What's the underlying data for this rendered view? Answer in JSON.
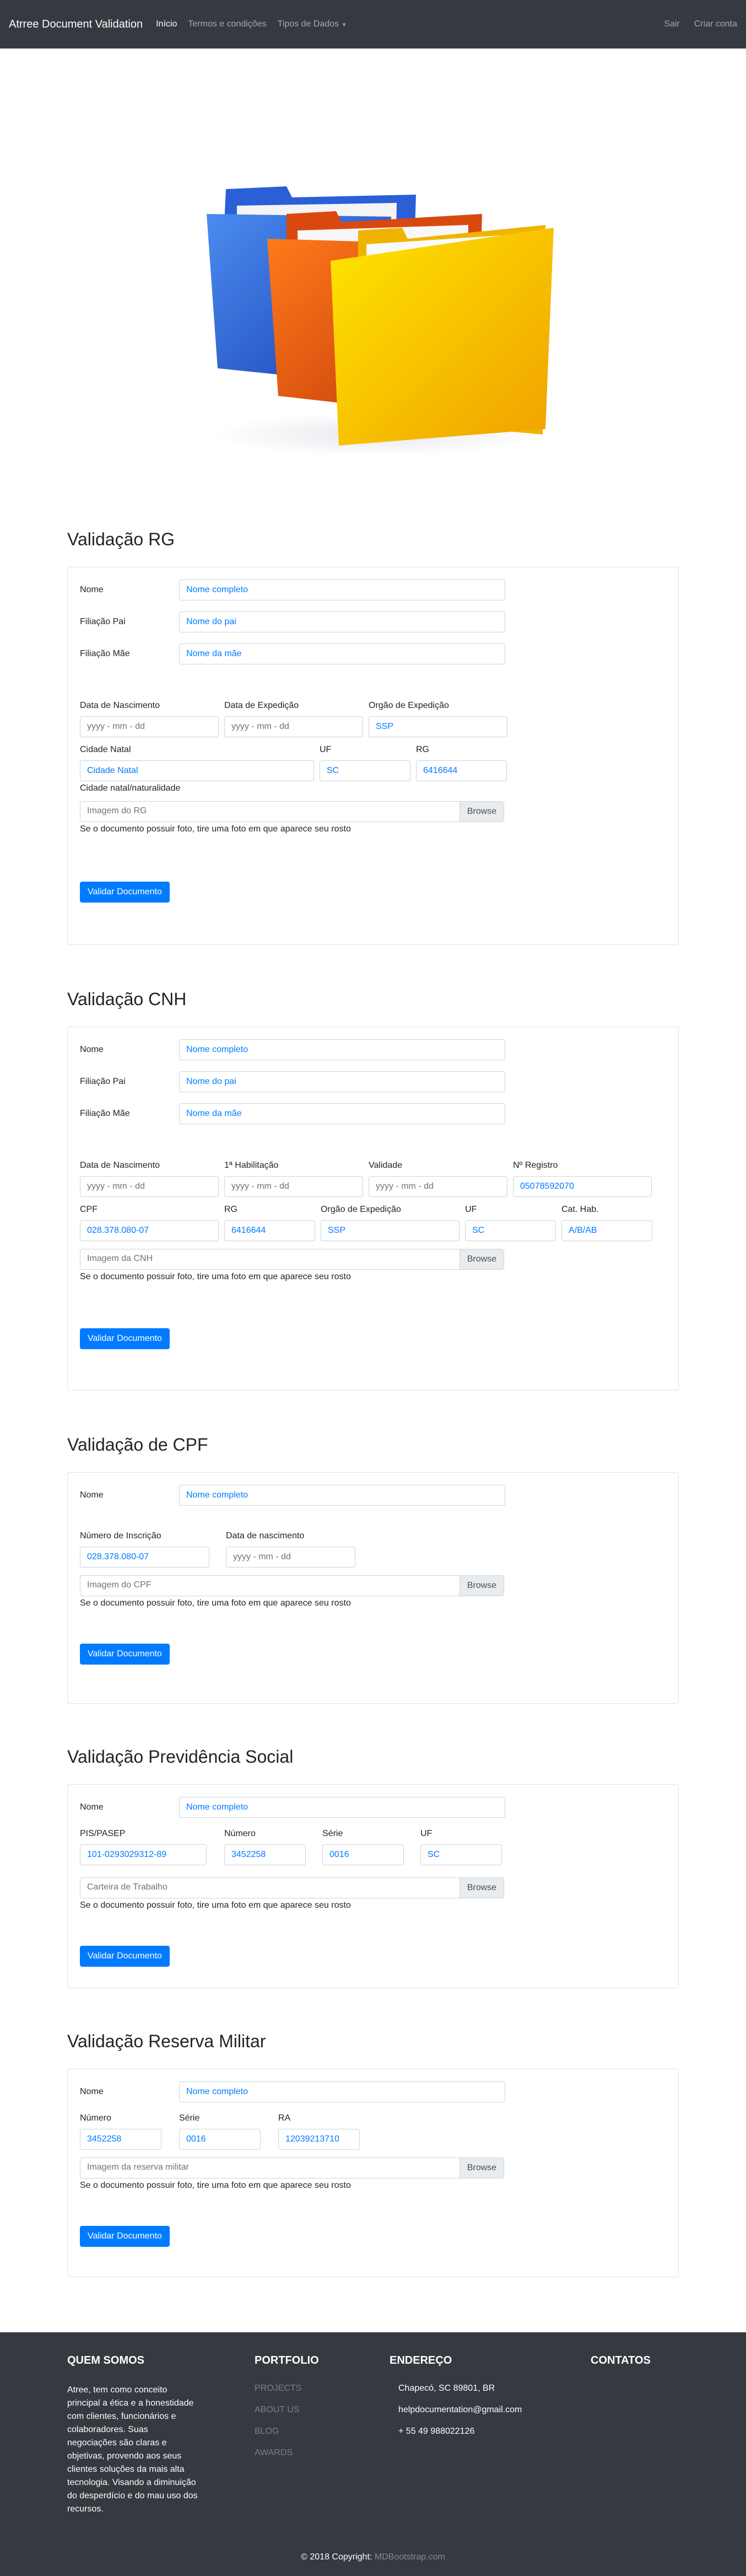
{
  "navbar": {
    "brand": "Atrree Document Validation",
    "links": [
      "Início",
      "Termos e condições",
      "Tipos de Dados"
    ],
    "right": [
      "Sair",
      "Criar conta"
    ]
  },
  "placeholders": {
    "nome": "Nome completo",
    "pai": "Nome do pai",
    "mae": "Nome da mãe",
    "date": "yyyy - mm - dd",
    "help": "Se o documento possuir foto, tire uma foto em que aparece seu rosto",
    "browse": "Browse",
    "validar": "Validar Documento"
  },
  "labels": {
    "nome": "Nome",
    "pai": "Filiação Pai",
    "mae": "Filiação Mãe"
  },
  "rg": {
    "title": "Validação RG",
    "col_nasc": "Data de Nascimento",
    "col_exp": "Data de Expedição",
    "col_org": "Orgão de Expedição",
    "org_val": "SSP",
    "col_cid": "Cidade Natal",
    "cid_val": "Cidade Natal",
    "cid_help": "Cidade natal/naturalidade",
    "col_uf": "UF",
    "uf_val": "SC",
    "col_rg": "RG",
    "rg_val": "6416644",
    "file": "Imagem do RG"
  },
  "cnh": {
    "title": "Validação CNH",
    "col_nasc": "Data de Nascimento",
    "col_hab": "1ª Habilitação",
    "col_val": "Validade",
    "col_reg": "Nº Registro",
    "reg_val": "05078592070",
    "col_cpf": "CPF",
    "cpf_val": "028.378.080-07",
    "col_rg": "RG",
    "rg_val": "6416644",
    "col_org": "Orgão de Expedição",
    "org_val": "SSP",
    "col_uf": "UF",
    "uf_val": "SC",
    "col_cat": "Cat. Hab.",
    "cat_val": "A/B/AB",
    "file": "Imagem da CNH"
  },
  "cpf": {
    "title": "Validação de CPF",
    "col_num": "Número de Inscrição",
    "num_val": "028.378.080-07",
    "col_nasc": "Data de nascimento",
    "file": "Imagem do CPF"
  },
  "prev": {
    "title": "Validação Previdência Social",
    "col_pis": "PIS/PASEP",
    "pis_val": "101-0293029312-89",
    "col_num": "Número",
    "num_val": "3452258",
    "col_serie": "Série",
    "serie_val": "0016",
    "col_uf": "UF",
    "uf_val": "SC",
    "file": "Carteira de Trabalho"
  },
  "mil": {
    "title": "Validação Reserva Militar",
    "col_num": "Número",
    "num_val": "3452258",
    "col_serie": "Série",
    "serie_val": "0016",
    "col_ra": "RA",
    "ra_val": "12039213710",
    "file": "Imagem da reserva militar"
  },
  "footer": {
    "about_title": "QUEM SOMOS",
    "about_text": "Atree, tem como conceito principal a ética e a honestidade com clientes, funcionários e colaboradores. Suas negociações são claras e objetivas, provendo aos seus clientes soluções da mais alta tecnologia. Visando a diminuição do desperdício e do mau uso dos recursos.",
    "portfolio_title": "PORTFOLIO",
    "portfolio_links": [
      "PROJECTS",
      "ABOUT US",
      "BLOG",
      "AWARDS"
    ],
    "address_title": "ENDEREÇO",
    "address_lines": [
      "Chapecó, SC 89801, BR",
      "helpdocumentation@gmail.com",
      "+ 55 49 988022126"
    ],
    "contacts_title": "CONTATOS",
    "copyright": "© 2018 Copyright:",
    "copyright_link": "MDBootstrap.com"
  },
  "colors": {
    "navbar": "#343a40",
    "primary": "#007bff",
    "footer": "#343a40"
  }
}
